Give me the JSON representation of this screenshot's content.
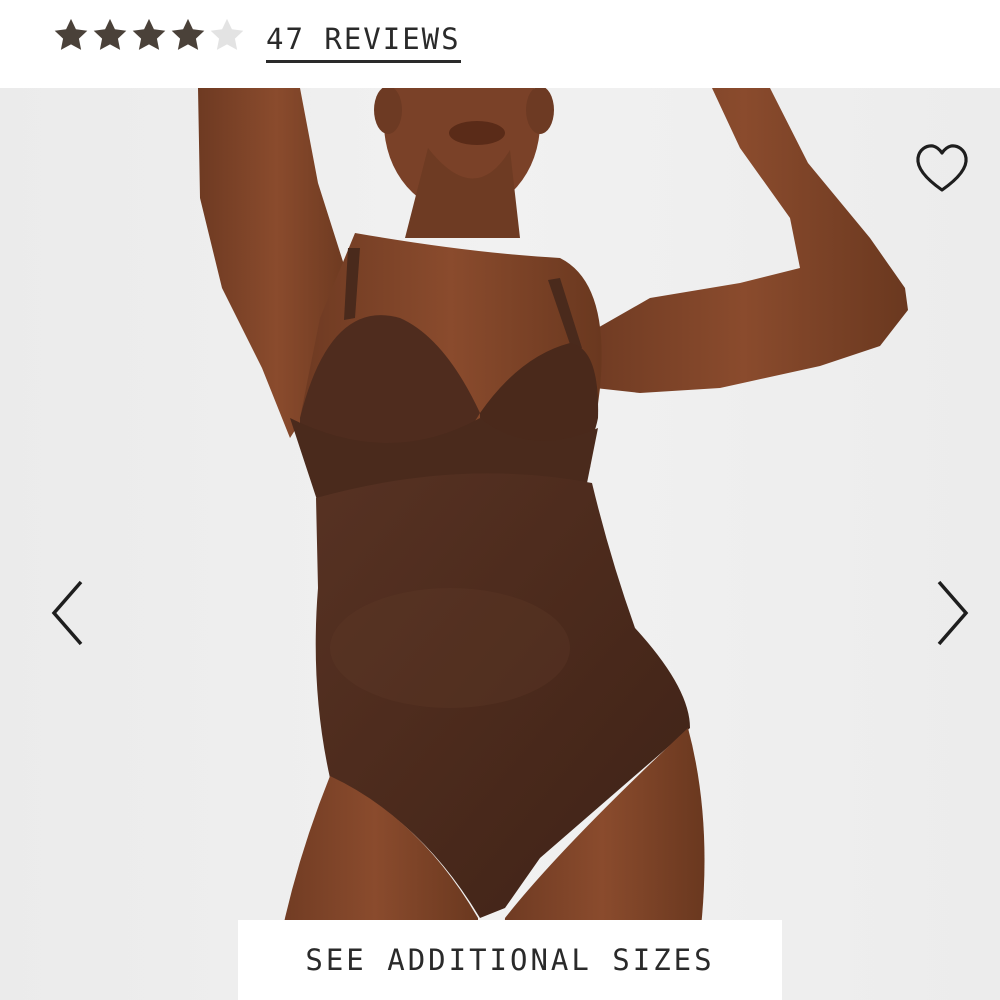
{
  "rating": {
    "value": 4,
    "max": 5,
    "filled_color": "#4a4139",
    "empty_color": "#e3e3e3",
    "reviews_label": "47 REVIEWS"
  },
  "gallery": {
    "prev_icon": "chevron-left-icon",
    "next_icon": "chevron-right-icon",
    "wishlist_icon": "heart-outline-icon",
    "garment_color": "#4b2a1c"
  },
  "cta": {
    "sizes_label": "SEE ADDITIONAL SIZES"
  }
}
